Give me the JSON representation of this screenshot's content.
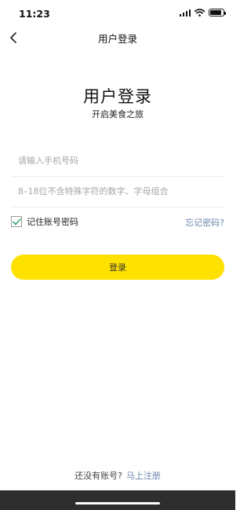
{
  "status_bar": {
    "time": "11:23",
    "icons": [
      "signal-icon",
      "wifi-icon",
      "battery-icon"
    ]
  },
  "nav": {
    "back_icon": "chevron-left-icon",
    "title": "用户登录"
  },
  "hero": {
    "title": "用户登录",
    "subtitle": "开启美食之旅"
  },
  "form": {
    "phone_placeholder": "请输入手机号码",
    "phone_value": "",
    "password_placeholder": "8–18位不含特殊字符的数字、字母组合",
    "password_value": "",
    "remember_label": "记住账号密码",
    "remember_checked": true,
    "forgot_label": "忘记密码?"
  },
  "login_button": {
    "label": "登录"
  },
  "signup": {
    "prompt": "还没有账号?",
    "link": "马上注册"
  },
  "colors": {
    "accent": "#ffe100",
    "link": "#6a87ad",
    "check": "#3aa86b",
    "bottom_bar": "#2e2e2e"
  }
}
